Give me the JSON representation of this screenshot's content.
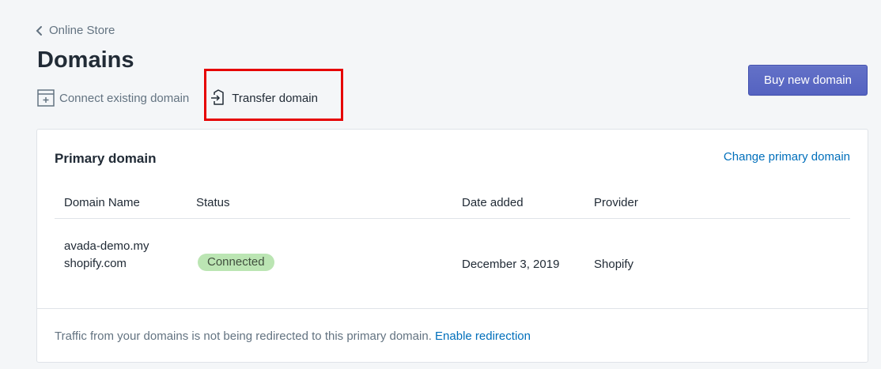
{
  "breadcrumb": {
    "label": "Online Store"
  },
  "page": {
    "title": "Domains"
  },
  "actions": {
    "connect_label": "Connect existing domain",
    "transfer_label": "Transfer domain"
  },
  "buy_button": {
    "label": "Buy new domain"
  },
  "primary_card": {
    "title": "Primary domain",
    "change_link": "Change primary domain",
    "columns": [
      "Domain Name",
      "Status",
      "Date added",
      "Provider"
    ],
    "rows": [
      {
        "domain": "avada-demo.myshopify.com",
        "status": "Connected",
        "date_added": "December 3, 2019",
        "provider": "Shopify"
      }
    ],
    "footer_text": "Traffic from your domains is not being redirected to this primary domain.",
    "footer_link": "Enable redirection"
  },
  "colors": {
    "accent": "#5c6ac4",
    "link": "#006fbb",
    "badge_success": "#bbe5b3",
    "highlight": "#e60000"
  }
}
